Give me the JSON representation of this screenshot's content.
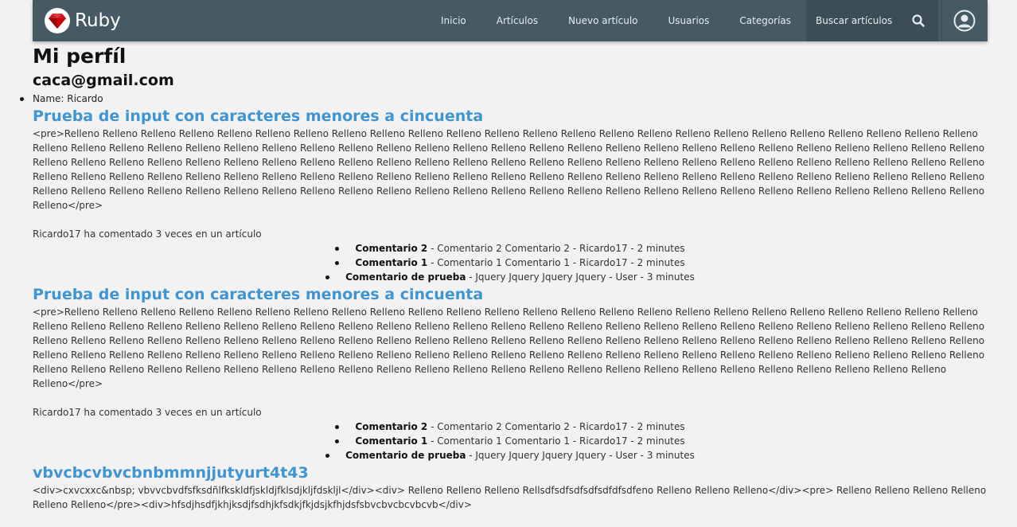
{
  "navbar": {
    "brand": "Ruby",
    "links": [
      "Inicio",
      "Artículos",
      "Nuevo artículo",
      "Usuarios",
      "Categorías"
    ],
    "search_link": "Buscar artículos",
    "colors": {
      "background": "#455a64",
      "active": "#3b4e57",
      "text": "#e6ecef"
    },
    "icons": {
      "logo": "ruby-gem-icon",
      "search": "search-icon",
      "user": "user-avatar-icon"
    }
  },
  "profile": {
    "title": "Mi perfíl",
    "email": "caca@gmail.com",
    "name_line": "Name: Ricardo"
  },
  "articles": [
    {
      "title": "Prueba de input con caracteres menores a cincuenta",
      "body": "<pre>Relleno Relleno Relleno Relleno Relleno Relleno Relleno Relleno Relleno Relleno Relleno Relleno Relleno Relleno Relleno Relleno Relleno Relleno Relleno Relleno Relleno Relleno Relleno Relleno Relleno Relleno Relleno Relleno Relleno Relleno Relleno Relleno Relleno Relleno Relleno Relleno Relleno Relleno Relleno Relleno Relleno Relleno Relleno Relleno Relleno Relleno Relleno Relleno Relleno Relleno Relleno Relleno Relleno Relleno Relleno Relleno Relleno Relleno Relleno Relleno Relleno Relleno Relleno Relleno Relleno Relleno Relleno Relleno Relleno Relleno Relleno Relleno Relleno Relleno Relleno Relleno Relleno Relleno Relleno Relleno Relleno Relleno Relleno Relleno Relleno Relleno Relleno Relleno Relleno Relleno Relleno Relleno Relleno Relleno Relleno Relleno Relleno Relleno Relleno Relleno Relleno Relleno Relleno Relleno Relleno Relleno Relleno Relleno Relleno Relleno Relleno Relleno Relleno Relleno Relleno Relleno Relleno Relleno Relleno Relleno Relleno Relleno Relleno Relleno Relleno</pre>",
      "comment_count": "Ricardo17 ha comentado 3 veces en un artículo",
      "comments": [
        {
          "title": "Comentario 2",
          "rest": " - Comentario 2 Comentario 2 - Ricardo17 - 2 minutes"
        },
        {
          "title": "Comentario 1",
          "rest": " - Comentario 1 Comentario 1 - Ricardo17 - 2 minutes"
        },
        {
          "title": "Comentario de prueba",
          "rest": " - Jquery Jquery Jquery Jquery - User - 3 minutes"
        }
      ]
    },
    {
      "title": "Prueba de input con caracteres menores a cincuenta",
      "body": "<pre>Relleno Relleno Relleno Relleno Relleno Relleno Relleno Relleno Relleno Relleno Relleno Relleno Relleno Relleno Relleno Relleno Relleno Relleno Relleno Relleno Relleno Relleno Relleno Relleno Relleno Relleno Relleno Relleno Relleno Relleno Relleno Relleno Relleno Relleno Relleno Relleno Relleno Relleno Relleno Relleno Relleno Relleno Relleno Relleno Relleno Relleno Relleno Relleno Relleno Relleno Relleno Relleno Relleno Relleno Relleno Relleno Relleno Relleno Relleno Relleno Relleno Relleno Relleno Relleno Relleno Relleno Relleno Relleno Relleno Relleno Relleno Relleno Relleno Relleno Relleno Relleno Relleno Relleno Relleno Relleno Relleno Relleno Relleno Relleno Relleno Relleno Relleno Relleno Relleno Relleno Relleno Relleno Relleno Relleno Relleno Relleno Relleno Relleno Relleno Relleno Relleno Relleno Relleno Relleno Relleno Relleno Relleno Relleno Relleno Relleno Relleno Relleno Relleno Relleno Relleno Relleno Relleno Relleno Relleno Relleno Relleno Relleno Relleno Relleno</pre>",
      "comment_count": "Ricardo17 ha comentado 3 veces en un artículo",
      "comments": [
        {
          "title": "Comentario 2",
          "rest": " - Comentario 2 Comentario 2 - Ricardo17 - 2 minutes"
        },
        {
          "title": "Comentario 1",
          "rest": " - Comentario 1 Comentario 1 - Ricardo17 - 2 minutes"
        },
        {
          "title": "Comentario de prueba",
          "rest": " - Jquery Jquery Jquery Jquery - User - 3 minutes"
        }
      ]
    },
    {
      "title": "vbvcbcvbvcbnbmmnjjutyurt4t43",
      "body": "<div>cxvcxxc&nbsp; vbvvcbvdfsfksdñlfkskldfjskldjfklsdjkljfdskljl</div><div> Relleno Relleno Relleno Rellsdfsdfsdfsdfsdfdfsdfeno Relleno Relleno Relleno</div><pre> Relleno Relleno Relleno Relleno Relleno Relleno</pre><div>hfsdjhsdfjkhjksdjfsdhjkfsdkjfkjdsjkfhjdsfsbvcbvcbcvbcvb</div>"
    }
  ]
}
